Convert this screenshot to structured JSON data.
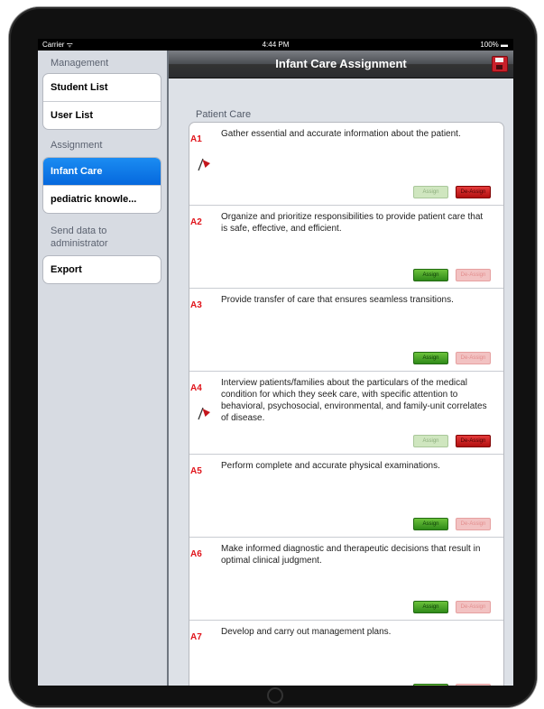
{
  "statusbar": {
    "carrier": "Carrier ᯤ",
    "time": "4:44 PM",
    "battery": "100% ▬"
  },
  "sidebar": {
    "management_header": "Management",
    "management_items": [
      "Student List",
      "User List"
    ],
    "assignment_header": "Assignment",
    "assignment_items": [
      "Infant Care",
      "pediatric knowle..."
    ],
    "send_header_line1": "Send data to",
    "send_header_line2": "administrator",
    "export_label": "Export"
  },
  "navbar": {
    "title": "Infant Care  Assignment"
  },
  "content": {
    "section_title": "Patient Care",
    "rows": [
      {
        "code": "A1",
        "text": "Gather essential and accurate information about the patient.",
        "flagged": true,
        "assign_label": "Assign",
        "deassign_label": "De-Assign"
      },
      {
        "code": "A2",
        "text": "Organize and prioritize responsibilities to provide patient care that is safe, effective, and efficient.",
        "flagged": false,
        "assign_label": "Assign",
        "deassign_label": "De-Assign"
      },
      {
        "code": "A3",
        "text": "Provide transfer of care that ensures seamless transitions.",
        "flagged": false,
        "assign_label": "Assign",
        "deassign_label": "De-Assign"
      },
      {
        "code": "A4",
        "text": "Interview patients/families about the particulars of the medical condition for which they seek care, with specific attention to behavioral, psychosocial, environmental, and family-unit correlates of disease.",
        "flagged": true,
        "assign_label": "Assign",
        "deassign_label": "De-Assign"
      },
      {
        "code": "A5",
        "text": "Perform complete and accurate physical examinations.",
        "flagged": false,
        "assign_label": "Assign",
        "deassign_label": "De-Assign"
      },
      {
        "code": "A6",
        "text": "Make informed diagnostic and therapeutic decisions that result in optimal clinical judgment.",
        "flagged": false,
        "assign_label": "Assign",
        "deassign_label": "De-Assign"
      },
      {
        "code": "A7",
        "text": "Develop and carry out management plans.",
        "flagged": false,
        "assign_label": "Assign",
        "deassign_label": "De-Assign"
      }
    ]
  },
  "colors": {
    "selected_blue": "#0a72e6",
    "code_red": "#e0141b",
    "assign_green": "#3a9a1f",
    "deassign_red": "#c01818"
  },
  "icons": {
    "save": "save-icon",
    "flag": "flag-icon"
  }
}
